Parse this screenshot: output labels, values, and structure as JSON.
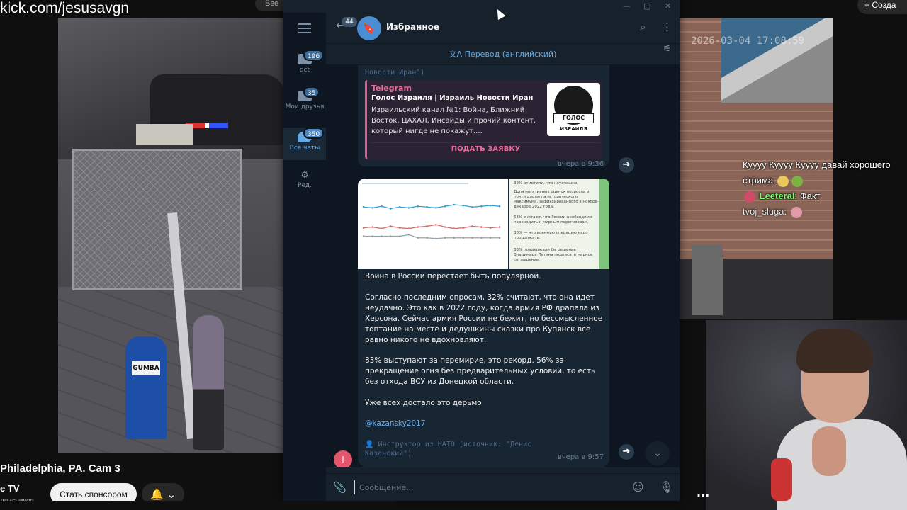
{
  "stream": {
    "url_overlay": "kick.com/jesusavgn",
    "video_title": "Philadelphia, PA. Cam 3",
    "channel_name": "e TV",
    "subscribers": "дписчиков",
    "sponsor_label": "Стать спонсором",
    "top_right_label": "Созда",
    "top_mid_label": "Вве",
    "timestamp": "2026-03-04 17:08:59",
    "mailbox_label": "GUMBA"
  },
  "chat_overlay": [
    {
      "name": "",
      "text": "Куууу Куууу Куууу давай хорошего стрима"
    },
    {
      "name": "Leeteral",
      "text": ": Факт"
    },
    {
      "name": "tvoj_sluga",
      "text": ":"
    }
  ],
  "telegram": {
    "window_controls": [
      "—",
      "▢",
      "✕"
    ],
    "sidebar": {
      "folders": [
        {
          "label": "dct",
          "badge": "196"
        },
        {
          "label": "Мои друзья",
          "badge": "35"
        },
        {
          "label": "Все чаты",
          "badge": "350"
        },
        {
          "label": "Ред.",
          "badge": ""
        }
      ]
    },
    "header": {
      "back_badge": "44",
      "title": "Избранное"
    },
    "translate_bar": "Перевод (английский)",
    "messages": {
      "source_top": "Новости Иран\")",
      "preview": {
        "site": "Telegram",
        "title": "Голос Израиля | Израиль Новости Иран",
        "description": "Израильский канал №1: Война, Ближний Восток, ЦАХАЛ, Инсайды и прочий контент, который нигде не покажут....",
        "thumb_label": "ГОЛОС",
        "thumb_sub": "ИЗРАИЛЯ",
        "button": "ПОДАТЬ ЗАЯВКУ"
      },
      "time1": "вчера в 9:36",
      "post": {
        "p1": "Война в России перестает быть популярной.",
        "p2": "Согласно последним опросам, 32% считают, что она идет неудачно. Это как в 2022 году, когда армия РФ драпала из Херсона. Сейчас армия России не бежит, но бессмысленное топтание на месте и дедушкины сказки про Купянск все равно никого не вдохновляют.",
        "p3": "83% выступают за перемирие, это рекорд. 56% за прекращение огня без предварительных условий, то есть без отхода ВСУ из Донецкой области.",
        "p4": "Уже всех достало это дерьмо",
        "link": "@kazansky2017",
        "source": "Инструктор из НАТО (источник: \"Денис Казанский\")",
        "time": "вчера в 9:57"
      },
      "media_text": [
        "32% отметили, что неуспешно.",
        "Доля негативных оценок возросла и почти достигла исторического максимума, зафиксированного в ноябре-декабре 2022 года.",
        "63% считают, что России необходимо переходить к мирным переговорам,",
        "38% — что военную операцию надо продолжать.",
        "83% поддержали бы решение Владимира Путина подписать мирное соглашение."
      ],
      "avatar_initial": "J"
    },
    "input_placeholder": "Сообщение..."
  },
  "chart_data": {
    "type": "line",
    "title": "",
    "categories": [
      "1",
      "2",
      "3",
      "4",
      "5",
      "6",
      "7",
      "8",
      "9",
      "10",
      "11",
      "12",
      "13",
      "14",
      "15",
      "16"
    ],
    "series": [
      {
        "name": "",
        "values": [
          55,
          54,
          56,
          53,
          55,
          54,
          56,
          55,
          54,
          56,
          58,
          57,
          55,
          56,
          57,
          56
        ]
      },
      {
        "name": "",
        "values": [
          28,
          29,
          27,
          30,
          28,
          27,
          29,
          30,
          32,
          29,
          27,
          28,
          30,
          29,
          28,
          29
        ]
      },
      {
        "name": "",
        "values": [
          17,
          17,
          17,
          17,
          17,
          19,
          15,
          15,
          14,
          15,
          15,
          15,
          15,
          15,
          15,
          15
        ]
      }
    ],
    "colors": [
      "#3aa0d8",
      "#d96a6a",
      "#9aa3ab"
    ]
  }
}
